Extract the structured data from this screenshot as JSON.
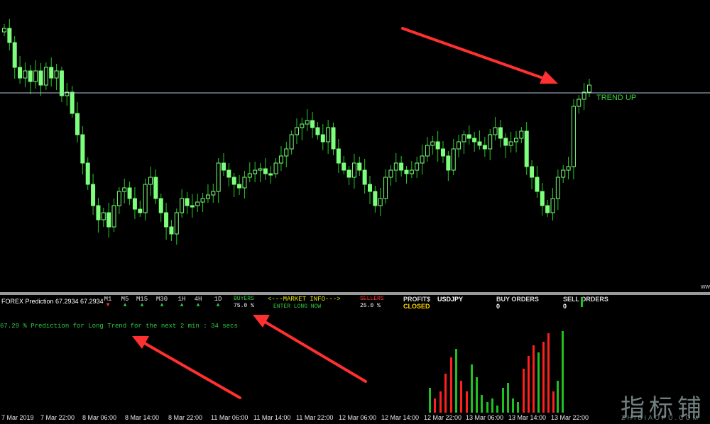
{
  "colors": {
    "bull": "#7dff7d",
    "bear": "#2aff2a",
    "wick": "#22cc22",
    "level": "#b0c4de",
    "arrow": "#ff3030",
    "hist_red": "#ff2020",
    "hist_green": "#20c020",
    "buyers": "#2ecc40",
    "sellers": "#ff3333",
    "info": "#e6e600",
    "closed": "#ffd700"
  },
  "main": {
    "trend_label": "TREND UP",
    "edge_label": "ww"
  },
  "info_bar": {
    "indicator": "FOREX Prediction 67.2934 67.2934",
    "timeframes": [
      {
        "label": "M1",
        "arrow": "▼",
        "dir": "down"
      },
      {
        "label": "M5",
        "arrow": "▲",
        "dir": "up"
      },
      {
        "label": "M15",
        "arrow": "▲",
        "dir": "up"
      },
      {
        "label": "M30",
        "arrow": "▲",
        "dir": "up"
      },
      {
        "label": "1H",
        "arrow": "▲",
        "dir": "up"
      },
      {
        "label": "4H",
        "arrow": "▲",
        "dir": "up"
      },
      {
        "label": "1D",
        "arrow": "▲",
        "dir": "up"
      }
    ],
    "buyers_label": "BUYERS",
    "buyers_value": "75.0 %",
    "market_info": "<---MARKET INFO--->",
    "market_action": "ENTER LONG NOW",
    "sellers_label": "SELLERS",
    "sellers_value": "25.0 %",
    "profit_label": "PROFIT$",
    "profit_status": "CLOSED",
    "symbol": "USDJPY",
    "buy_orders_label": "BUY ORDERS",
    "buy_orders_value": "0",
    "sell_orders_label": "SELL ORDERS",
    "sell_orders_value": "0",
    "prediction": "67.29 % Prediction for Long Trend for the next 2 min : 34 secs"
  },
  "time_axis": [
    "7 Mar 2019",
    "7 Mar 22:00",
    "8 Mar 06:00",
    "8 Mar 14:00",
    "8 Mar 22:00",
    "11 Mar 06:00",
    "11 Mar 14:00",
    "11 Mar 22:00",
    "12 Mar 06:00",
    "12 Mar 14:00",
    "12 Mar 22:00",
    "13 Mar 06:00",
    "13 Mar 14:00",
    "13 Mar 22:00"
  ],
  "watermark": {
    "main": "指标铺",
    "sub": "ZHIBIAOPU.COM"
  }
}
